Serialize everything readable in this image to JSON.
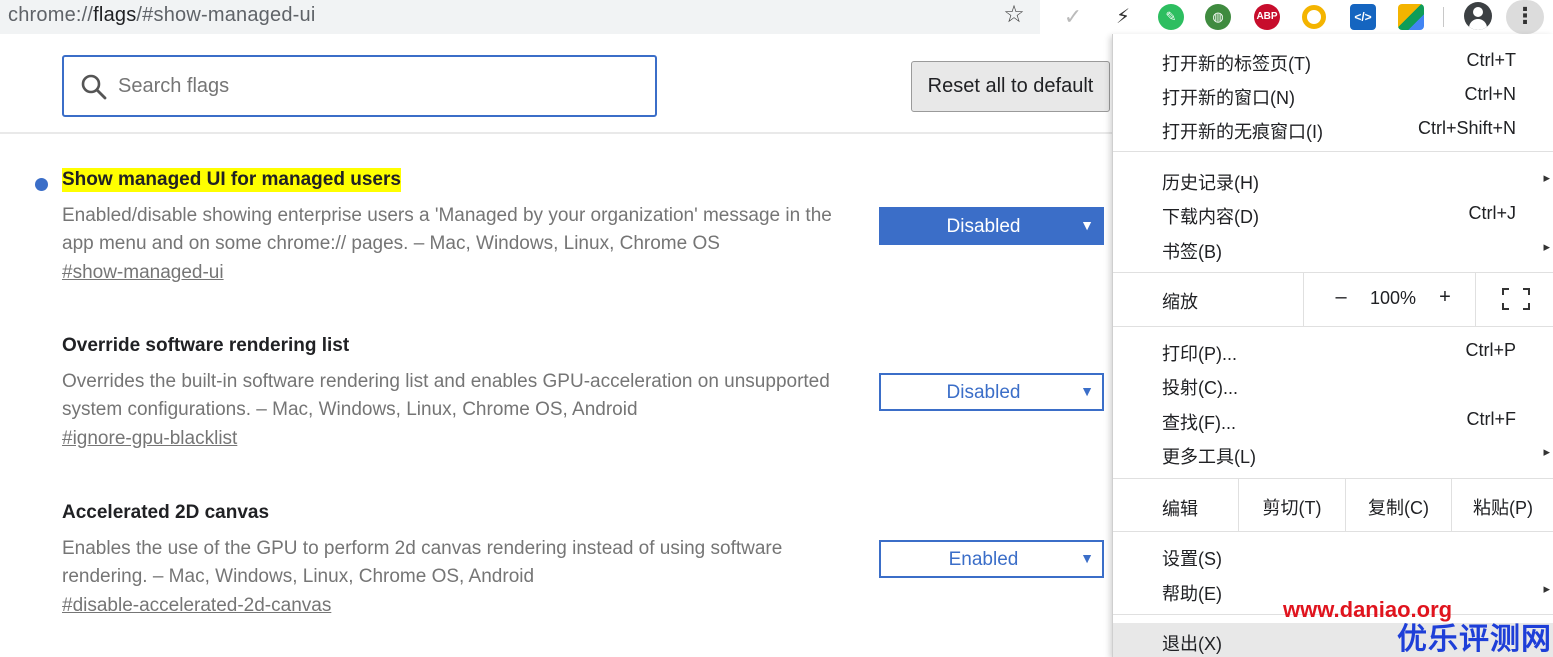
{
  "address_bar": {
    "url_scheme": "chrome://",
    "url_host": "flags",
    "url_path": "/#show-managed-ui"
  },
  "toolbar": {
    "bookmark_icon": "star-icon",
    "extensions": [
      "check-icon",
      "flash-icon",
      "evernote-icon",
      "globe-icon",
      "abp-icon",
      "ring-icon",
      "code-icon",
      "drive-icon"
    ],
    "abp_label": "ABP",
    "code_label": "</>",
    "menu_icon": "kebab-icon"
  },
  "flags": {
    "search_placeholder": "Search flags",
    "reset_label": "Reset all to default",
    "experiments": [
      {
        "title": "Show managed UI for managed users",
        "description": "Enabled/disable showing enterprise users a 'Managed by your organization' message in the app menu and on some chrome:// pages. – Mac, Windows, Linux, Chrome OS",
        "link": "#show-managed-ui",
        "value": "Disabled",
        "highlighted": true
      },
      {
        "title": "Override software rendering list",
        "description": "Overrides the built-in software rendering list and enables GPU-acceleration on unsupported system configurations. – Mac, Windows, Linux, Chrome OS, Android",
        "link": "#ignore-gpu-blacklist",
        "value": "Disabled",
        "highlighted": false
      },
      {
        "title": "Accelerated 2D canvas",
        "description": "Enables the use of the GPU to perform 2d canvas rendering instead of using software rendering. – Mac, Windows, Linux, Chrome OS, Android",
        "link": "#disable-accelerated-2d-canvas",
        "value": "Enabled",
        "highlighted": false
      }
    ]
  },
  "menu": {
    "new_tab": "打开新的标签页(T)",
    "new_tab_sc": "Ctrl+T",
    "new_window": "打开新的窗口(N)",
    "new_window_sc": "Ctrl+N",
    "incognito": "打开新的无痕窗口(I)",
    "incognito_sc": "Ctrl+Shift+N",
    "history": "历史记录(H)",
    "downloads": "下载内容(D)",
    "downloads_sc": "Ctrl+J",
    "bookmarks": "书签(B)",
    "zoom_label": "缩放",
    "zoom_minus": "–",
    "zoom_value": "100%",
    "zoom_plus": "+",
    "print": "打印(P)...",
    "print_sc": "Ctrl+P",
    "cast": "投射(C)...",
    "find": "查找(F)...",
    "find_sc": "Ctrl+F",
    "more_tools": "更多工具(L)",
    "edit_label": "编辑",
    "cut": "剪切(T)",
    "copy": "复制(C)",
    "paste": "粘贴(P)",
    "settings": "设置(S)",
    "help": "帮助(E)",
    "exit": "退出(X)",
    "submenu_arrow": "▸"
  },
  "watermark": {
    "url": "www.daniao.org",
    "logo": "优乐评测网"
  },
  "colors": {
    "accent": "#3b6ec8",
    "highlight": "#ffff00",
    "watermark_red": "#e0141e",
    "watermark_blue": "#1e3fd8"
  }
}
